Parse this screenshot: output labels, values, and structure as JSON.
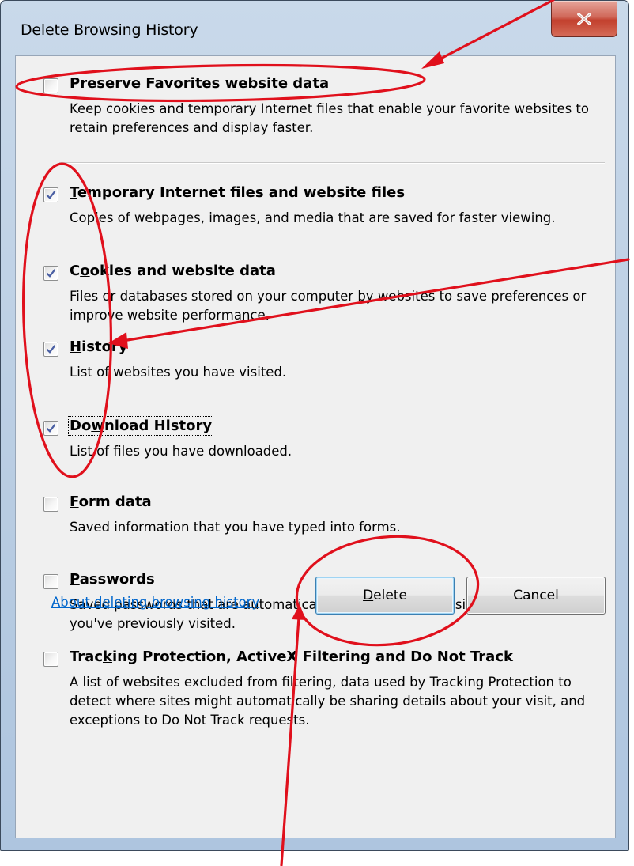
{
  "dialog": {
    "title": "Delete Browsing History"
  },
  "options": [
    {
      "mnemonic": "P",
      "rest": "reserve Favorites website data",
      "checked": false,
      "description": "Keep cookies and temporary Internet files that enable your favorite websites to retain preferences and display faster."
    },
    {
      "mnemonic": "T",
      "rest": "emporary Internet files and website files",
      "checked": true,
      "description": "Copies of webpages, images, and media that are saved for faster viewing."
    },
    {
      "before": "C",
      "mnemonic": "o",
      "rest": "okies and website data",
      "checked": true,
      "description": "Files or databases stored on your computer by websites to save preferences or improve website performance."
    },
    {
      "mnemonic": "H",
      "rest": "istory",
      "checked": true,
      "description": "List of websites you have visited."
    },
    {
      "before": "Do",
      "mnemonic": "w",
      "rest": "nload History",
      "checked": true,
      "description": "List of files you have downloaded."
    },
    {
      "mnemonic": "F",
      "rest": "orm data",
      "checked": false,
      "description": "Saved information that you have typed into forms."
    },
    {
      "mnemonic": "P",
      "rest": "asswords",
      "checked": false,
      "description": "Saved passwords that are automatically filled in when you sign in to a website you've previously visited."
    },
    {
      "before": "Trac",
      "mnemonic": "k",
      "rest": "ing Protection, ActiveX Filtering and Do Not Track",
      "checked": false,
      "description": "A list of websites excluded from filtering, data used by Tracking Protection to detect where sites might automatically be sharing details about your visit, and exceptions to Do Not Track requests."
    }
  ],
  "footer": {
    "help_link": "About deleting browsing history",
    "delete_mnemonic": "D",
    "delete_rest": "elete",
    "cancel_label": "Cancel"
  },
  "colors": {
    "annotation_red": "#e0101c",
    "link_blue": "#0066cc",
    "checkmark": "#4a5fa3"
  }
}
